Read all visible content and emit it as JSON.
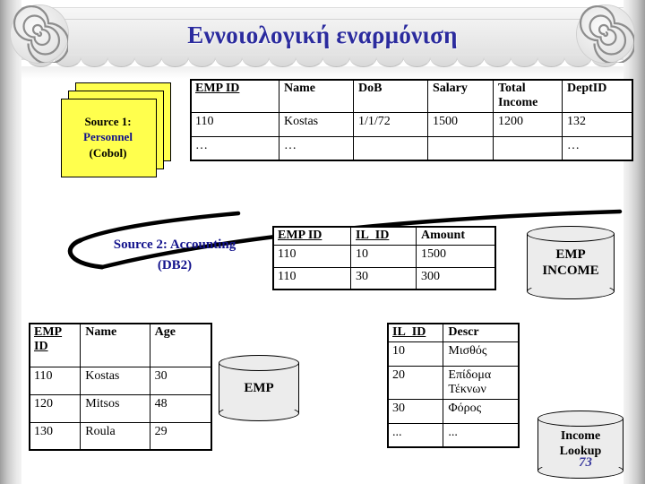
{
  "slide": {
    "title": "Εννοιολογική εναρμόνιση",
    "number": "73",
    "title_color": "#2b2b9e"
  },
  "source1": {
    "line1": "Source 1:",
    "line2": "Personnel",
    "line3": "(Cobol)",
    "shape": "stacked-documents",
    "fill": "#ffff4d",
    "accent_color": "#12128c"
  },
  "source2": {
    "line1": "Source 2: Accounting",
    "line2": "(DB2)",
    "color": "#12128c"
  },
  "personnel_table": {
    "headers": [
      "EMP ID",
      "Name",
      "DoB",
      "Salary",
      "Total Income",
      "DeptID"
    ],
    "primary_keys": [
      "EMP ID"
    ],
    "rows": [
      [
        "110",
        "Kostas",
        "1/1/72",
        "1500",
        "1200",
        "132"
      ],
      [
        "…",
        "…",
        "",
        "",
        "",
        "…"
      ]
    ]
  },
  "accounting_table": {
    "headers": [
      "EMP ID",
      "IL_ID",
      "Amount"
    ],
    "primary_keys": [
      "EMP ID",
      "IL_ID"
    ],
    "rows": [
      [
        "110",
        "10",
        "1500"
      ],
      [
        "110",
        "30",
        "300"
      ]
    ]
  },
  "emp_table": {
    "headers": [
      "EMP ID",
      "Name",
      "Age"
    ],
    "primary_keys": [
      "EMP ID"
    ],
    "rows": [
      [
        "110",
        "Kostas",
        "30"
      ],
      [
        "120",
        "Mitsos",
        "48"
      ],
      [
        "130",
        "Roula",
        "29"
      ]
    ]
  },
  "lookup_table": {
    "headers": [
      "IL_ID",
      "Descr"
    ],
    "primary_keys": [
      "IL_ID"
    ],
    "rows": [
      [
        "10",
        "Μισθός"
      ],
      [
        "20",
        "Επίδομα Τέκνων"
      ],
      [
        "30",
        "Φόρος"
      ],
      [
        "...",
        "..."
      ]
    ]
  },
  "cylinders": {
    "emp_income": "EMP INCOME",
    "emp": "EMP",
    "income_lookup": "Income Lookup"
  }
}
